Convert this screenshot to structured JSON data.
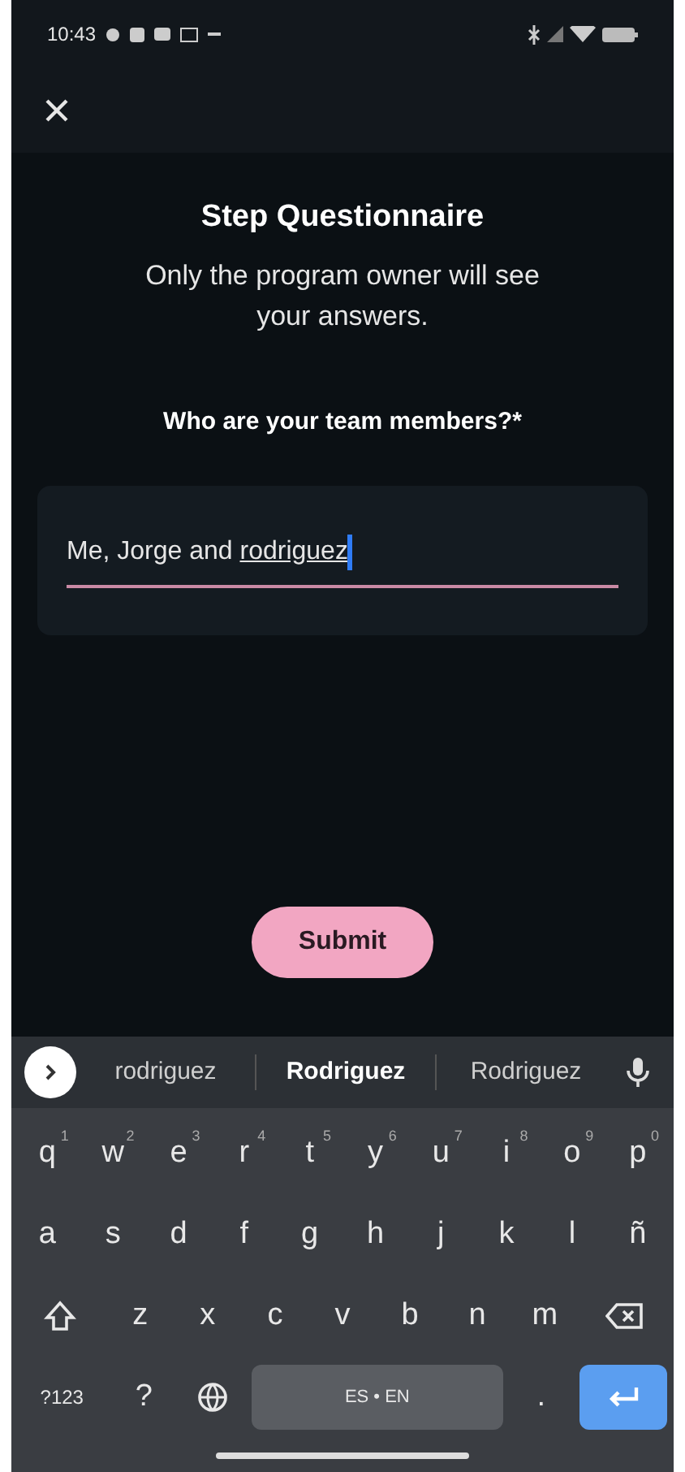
{
  "status_bar": {
    "time": "10:43"
  },
  "questionnaire": {
    "title": "Step Questionnaire",
    "subtitle": "Only the program owner will see your answers.",
    "question": "Who are your team members?*",
    "answer": {
      "value": "Me, Jorge and ",
      "composing": "rodriguez"
    }
  },
  "submit": {
    "label": "Submit"
  },
  "keyboard": {
    "suggestions": [
      {
        "text": "rodriguez",
        "selected": false
      },
      {
        "text": "Rodriguez",
        "selected": true
      },
      {
        "text": "Rodriguez",
        "selected": false
      }
    ],
    "rows": [
      {
        "keys": [
          {
            "kind": "letter",
            "label": "q",
            "hint": "1"
          },
          {
            "kind": "letter",
            "label": "w",
            "hint": "2"
          },
          {
            "kind": "letter",
            "label": "e",
            "hint": "3"
          },
          {
            "kind": "letter",
            "label": "r",
            "hint": "4"
          },
          {
            "kind": "letter",
            "label": "t",
            "hint": "5"
          },
          {
            "kind": "letter",
            "label": "y",
            "hint": "6"
          },
          {
            "kind": "letter",
            "label": "u",
            "hint": "7"
          },
          {
            "kind": "letter",
            "label": "i",
            "hint": "8"
          },
          {
            "kind": "letter",
            "label": "o",
            "hint": "9"
          },
          {
            "kind": "letter",
            "label": "p",
            "hint": "0"
          }
        ]
      },
      {
        "keys": [
          {
            "kind": "letter",
            "label": "a"
          },
          {
            "kind": "letter",
            "label": "s"
          },
          {
            "kind": "letter",
            "label": "d"
          },
          {
            "kind": "letter",
            "label": "f"
          },
          {
            "kind": "letter",
            "label": "g"
          },
          {
            "kind": "letter",
            "label": "h"
          },
          {
            "kind": "letter",
            "label": "j"
          },
          {
            "kind": "letter",
            "label": "k"
          },
          {
            "kind": "letter",
            "label": "l"
          },
          {
            "kind": "letter",
            "label": "ñ"
          }
        ]
      },
      {
        "keys": [
          {
            "kind": "shift"
          },
          {
            "kind": "letter",
            "label": "z"
          },
          {
            "kind": "letter",
            "label": "x"
          },
          {
            "kind": "letter",
            "label": "c"
          },
          {
            "kind": "letter",
            "label": "v"
          },
          {
            "kind": "letter",
            "label": "b"
          },
          {
            "kind": "letter",
            "label": "n"
          },
          {
            "kind": "letter",
            "label": "m"
          },
          {
            "kind": "backspace"
          }
        ]
      },
      {
        "keys": [
          {
            "kind": "letter",
            "label": "?123"
          },
          {
            "kind": "letter",
            "label": "?"
          },
          {
            "kind": "globe"
          },
          {
            "kind": "space",
            "label": "ES • EN"
          },
          {
            "kind": "letter",
            "label": "."
          },
          {
            "kind": "enter"
          }
        ]
      }
    ]
  }
}
